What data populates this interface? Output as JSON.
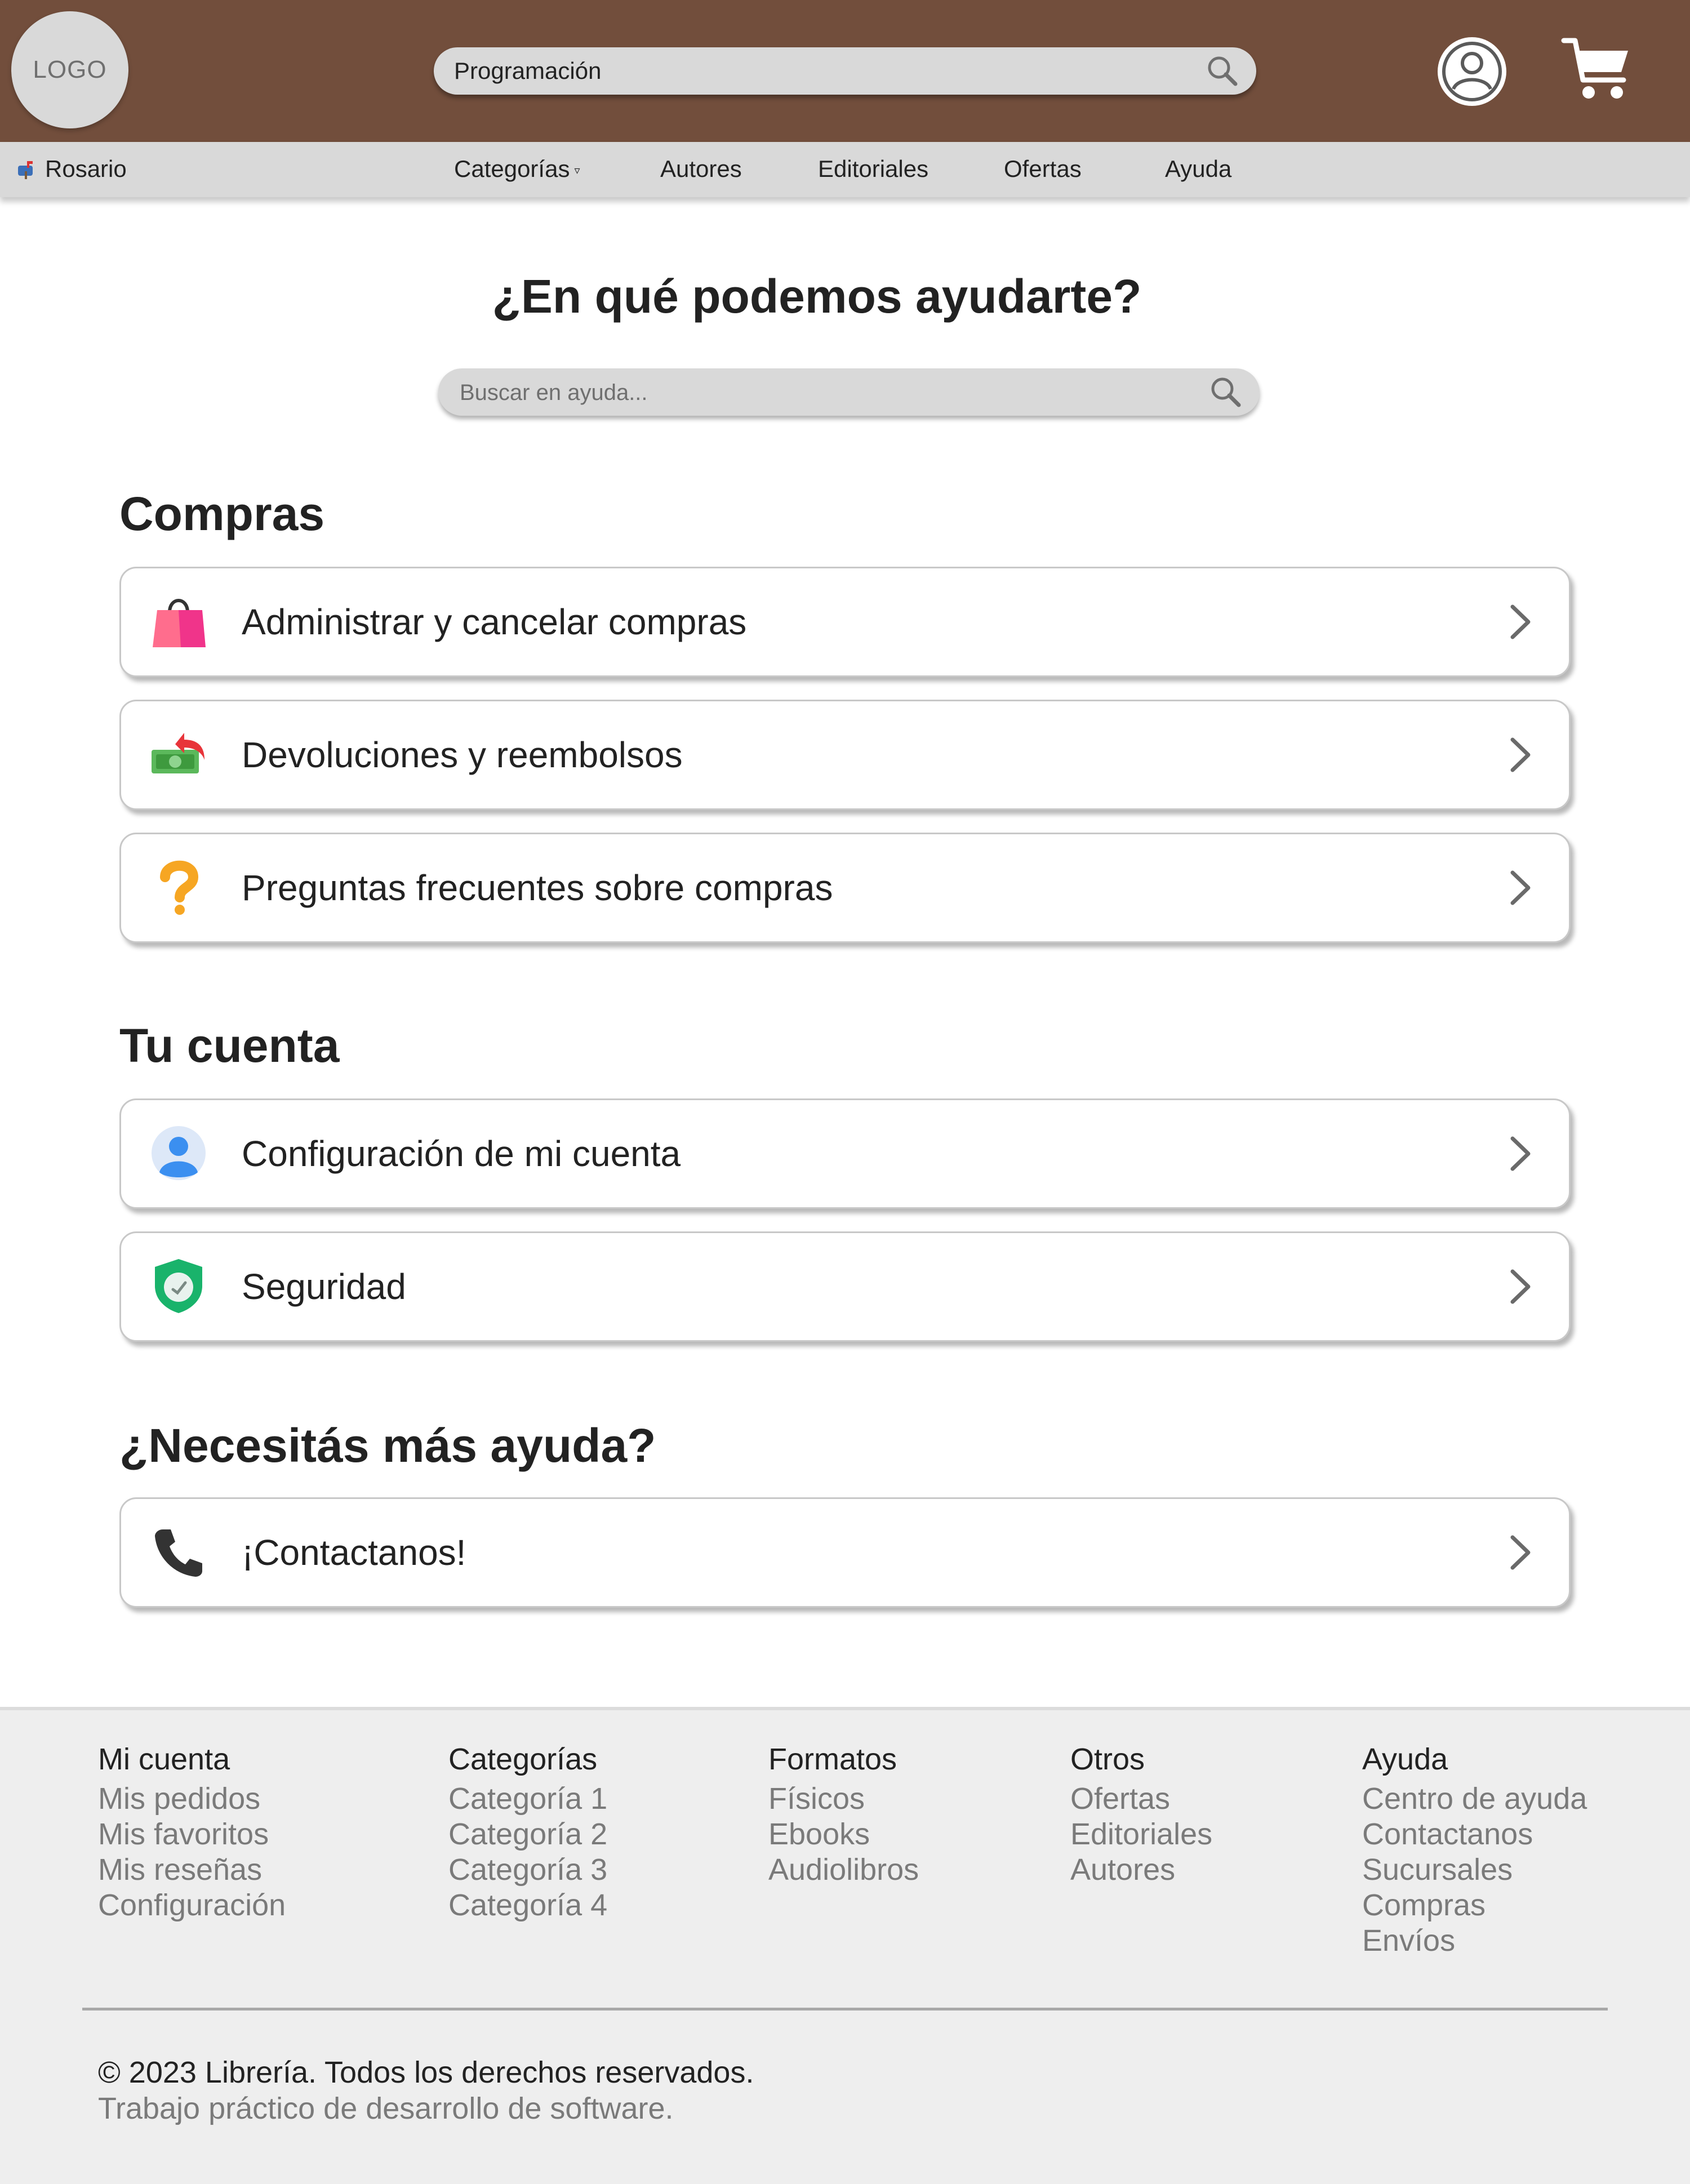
{
  "header": {
    "logo_text": "LOGO",
    "search_value": "Programación"
  },
  "nav": {
    "location": "Rosario",
    "items": [
      "Categorías",
      "Autores",
      "Editoriales",
      "Ofertas",
      "Ayuda"
    ]
  },
  "hero": {
    "title": "¿En qué podemos ayudarte?",
    "search_placeholder": "Buscar en ayuda..."
  },
  "sections": [
    {
      "title": "Compras",
      "items": [
        {
          "label": "Administrar y cancelar compras",
          "icon": "shopping-bag-icon"
        },
        {
          "label": "Devoluciones y reembolsos",
          "icon": "money-return-icon"
        },
        {
          "label": "Preguntas frecuentes sobre compras",
          "icon": "question-mark-icon"
        }
      ]
    },
    {
      "title": "Tu cuenta",
      "items": [
        {
          "label": "Configuración de mi cuenta",
          "icon": "user-account-icon"
        },
        {
          "label": "Seguridad",
          "icon": "shield-icon"
        }
      ]
    },
    {
      "title": "¿Necesitás más ayuda?",
      "items": [
        {
          "label": "¡Contactanos!",
          "icon": "phone-icon"
        }
      ]
    }
  ],
  "footer": {
    "columns": [
      {
        "title": "Mi cuenta",
        "links": [
          "Mis pedidos",
          "Mis favoritos",
          "Mis reseñas",
          "Configuración"
        ]
      },
      {
        "title": "Categorías",
        "links": [
          "Categoría 1",
          "Categoría 2",
          "Categoría 3",
          "Categoría 4"
        ]
      },
      {
        "title": "Formatos",
        "links": [
          "Físicos",
          "Ebooks",
          "Audiolibros"
        ]
      },
      {
        "title": "Otros",
        "links": [
          "Ofertas",
          "Editoriales",
          "Autores"
        ]
      },
      {
        "title": "Ayuda",
        "links": [
          "Centro de ayuda",
          "Contactanos",
          "Sucursales",
          "Compras",
          "Envíos"
        ]
      }
    ],
    "copyright": "© 2023 Librería. Todos los derechos reservados.",
    "subtitle": "Trabajo práctico de desarrollo de software."
  },
  "colors": {
    "header_bg": "#724e3c",
    "nav_bg": "#d9d9d9",
    "footer_bg": "#eeeeee"
  }
}
